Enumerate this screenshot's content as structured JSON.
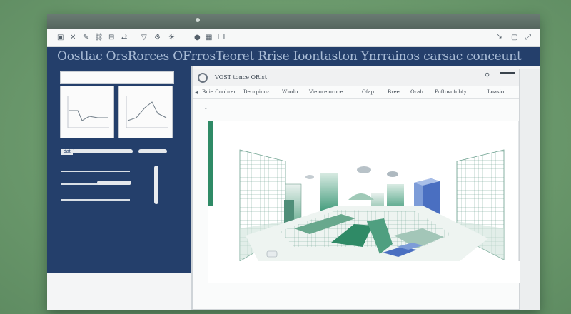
{
  "window": {
    "banner_title": "Oostlac OrsRorces OFrrosTeoret Rrise Ioontaston Ynrrainos carsac conceunt"
  },
  "toolbar": {
    "icons": [
      "folder-icon",
      "delete-icon",
      "edit-icon",
      "link-icon",
      "tag-icon",
      "move-icon",
      "filter-icon",
      "settings-icon",
      "brightness-icon",
      "light-icon",
      "grid-icon",
      "copy-icon",
      "paste-icon",
      "export-icon",
      "expand-icon"
    ]
  },
  "sidebar": {
    "slider_label": "dat"
  },
  "inner": {
    "title": "VOST tonce ORist",
    "menu": [
      "Bnie Cnobren",
      "Deorpinoz",
      "Wiodo",
      "Vieiore ornce",
      "Ofap",
      "Bree",
      "Orab",
      "Poftovotobty",
      "Loasio"
    ]
  },
  "colors": {
    "accent": "#243f6b",
    "banner_text": "#a9bcd6",
    "green": "#2f8a66",
    "blue_block": "#4a6fc1"
  }
}
